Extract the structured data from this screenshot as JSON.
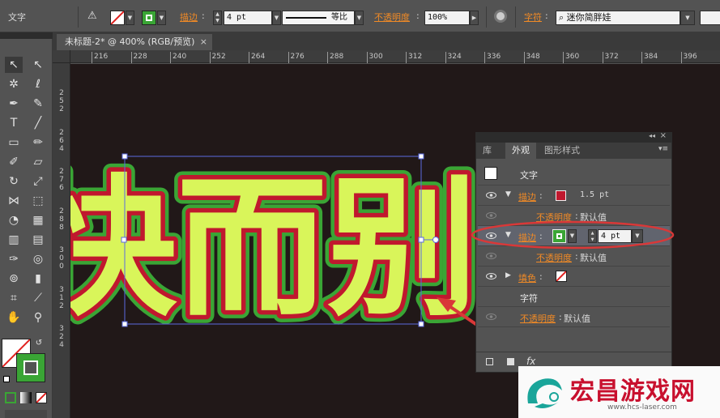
{
  "control_bar": {
    "selection_type": "文字",
    "stroke_label": "描边",
    "stroke_weight": "4 pt",
    "stroke_profile": "等比",
    "opacity_label": "不透明度",
    "opacity_value": "100%",
    "char_label": "字符",
    "font_value": "迷你简胖娃"
  },
  "document_tab": {
    "title": "未标题-2* @ 400% (RGB/预览)",
    "close": "×"
  },
  "ruler": {
    "h_ticks": [
      "216",
      "228",
      "240",
      "252",
      "264",
      "276",
      "288",
      "300",
      "312",
      "324",
      "336",
      "348",
      "360",
      "372",
      "384",
      "396"
    ],
    "v_ticks": [
      [
        "2",
        "5",
        "2"
      ],
      [
        "2",
        "6",
        "4"
      ],
      [
        "2",
        "7",
        "6"
      ],
      [
        "2",
        "8",
        "8"
      ],
      [
        "3",
        "0",
        "0"
      ],
      [
        "3",
        "1",
        "2"
      ],
      [
        "3",
        "2",
        "4"
      ]
    ]
  },
  "artwork": {
    "text": "快而别"
  },
  "appearance_panel": {
    "tabs": [
      "库",
      "外观",
      "图形样式"
    ],
    "active_tab": "外观",
    "rows": {
      "object_label": "文字",
      "stroke1_label": "描边",
      "stroke1_weight": "1.5 pt",
      "stroke1_opacity_label": "不透明度",
      "stroke1_opacity_value": "默认值",
      "stroke2_label": "描边",
      "stroke2_weight": "4 pt",
      "stroke2_opacity_label": "不透明度",
      "stroke2_opacity_value": "默认值",
      "fill_label": "填色",
      "characters_label": "字符",
      "object_opacity_label": "不透明度",
      "object_opacity_value": "默认值"
    },
    "footer": {
      "fx": "fx"
    }
  },
  "watermark": {
    "title": "宏昌游戏网",
    "url": "www.hcs-laser.com"
  },
  "colors": {
    "stroke_red": "#c0182e",
    "stroke_green": "#3aa535",
    "fill_yellow": "#d9f55a",
    "accent_orange": "#f08a26",
    "annotation_red": "#d93838",
    "canvas_bg": "#211818",
    "watermark_teal": "#1aa59a",
    "watermark_red": "#c8102e"
  }
}
